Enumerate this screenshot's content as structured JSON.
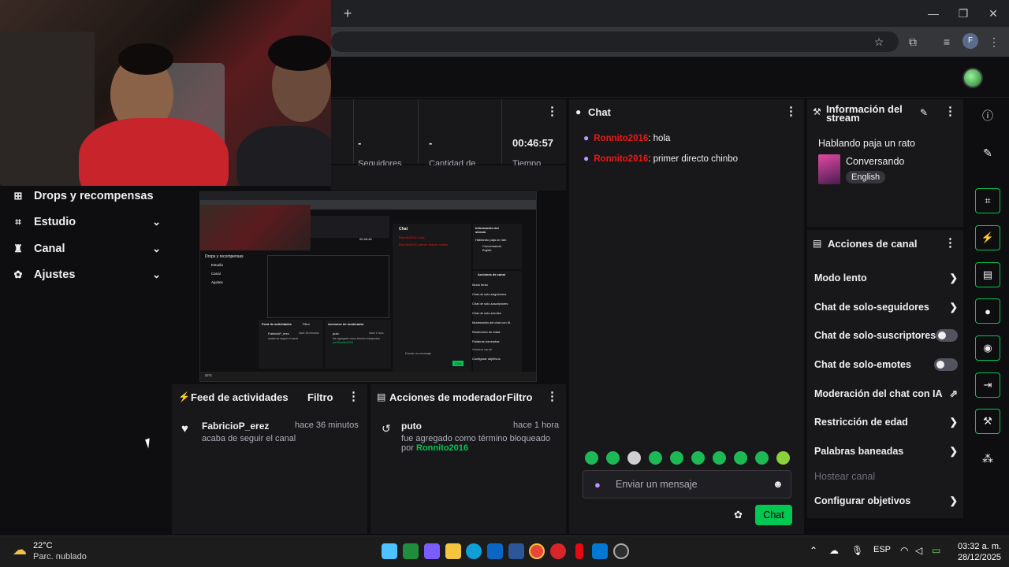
{
  "browser": {
    "new_tab_glyph": "+",
    "window_minimize": "—",
    "window_maximize": "❐",
    "window_close": "✕",
    "profile_initial": "F"
  },
  "stats": {
    "followers_value": "-",
    "followers_label": "Seguidores",
    "amount_value": "-",
    "amount_label": "Cantidad de",
    "time_value": "00:46:57",
    "time_label": "Tiempo"
  },
  "sidebar": {
    "items": [
      {
        "label": "Drops y recompensas",
        "icon": "gift-icon"
      },
      {
        "label": "Estudio",
        "icon": "studio-icon"
      },
      {
        "label": "Canal",
        "icon": "channel-icon"
      },
      {
        "label": "Ajustes",
        "icon": "gear-icon"
      }
    ]
  },
  "activity_feed": {
    "title": "Feed de actividades",
    "filter": "Filtro",
    "user": "FabricioP_erez",
    "time": "hace 36 minutos",
    "text": "acaba de seguir el canal"
  },
  "mod_actions": {
    "title": "Acciones de moderador",
    "filter": "Filtro",
    "term": "puto",
    "time": "hace 1 hora",
    "text": "fue agregado como término bloqueado",
    "by": "por",
    "moderator": "Ronnito2016"
  },
  "chat": {
    "title": "Chat",
    "messages": [
      {
        "user": "Ronnito2016",
        "text": ": hola"
      },
      {
        "user": "Ronnito2016",
        "text": ": primer directo chinbo"
      }
    ],
    "input_placeholder": "Enviar un mensaje",
    "send_label": "Chat"
  },
  "stream_info": {
    "title_line1": "Información del",
    "title_line2": "stream",
    "stream_title": "Hablando paja un rato",
    "category": "Conversando",
    "language": "English"
  },
  "channel_actions": {
    "title": "Acciones de canal",
    "items": [
      {
        "label": "Modo lento",
        "control": "chevron"
      },
      {
        "label": "Chat de solo-seguidores",
        "control": "chevron"
      },
      {
        "label": "Chat de solo-suscriptores",
        "control": "toggle"
      },
      {
        "label": "Chat de solo-emotes",
        "control": "toggle"
      },
      {
        "label": "Moderación del chat con IA",
        "control": "external"
      },
      {
        "label": "Restricción de edad",
        "control": "chevron"
      },
      {
        "label": "Palabras baneadas",
        "control": "chevron"
      },
      {
        "label": "Hostear canal",
        "control": "none"
      },
      {
        "label": "Configurar objetivos",
        "control": "chevron"
      }
    ]
  },
  "taskbar": {
    "weather_temp": "22°C",
    "weather_desc": "Parc. nublado",
    "language": "ESP",
    "time": "03:32 a. m.",
    "date": "28/12/2025"
  },
  "preview": {
    "side_labels": [
      "Drops y recompensas",
      "Estudio",
      "Canal",
      "Ajustes"
    ],
    "chat_title": "Chat",
    "info_title": "Información del stream",
    "stream_title": "Hablando paja un rato",
    "category": "Conversando",
    "language": "English",
    "action_labels": [
      "Acciones de canal",
      "Modo lento",
      "Chat de solo-seguidores",
      "Chat de solo-suscriptores",
      "Chat de solo-emotes",
      "Moderación del chat con IA",
      "Restricción de edad",
      "Palabras baneadas",
      "Hostear canal",
      "Configurar objetivos"
    ],
    "feed_title": "Feed de actividades",
    "mod_title": "Acciones de moderador",
    "filter": "Filtro",
    "feed_user": "FabricioP_erez",
    "feed_time": "hace 36 minutos",
    "feed_text": "acaba de seguir el canal",
    "mod_term": "puto",
    "mod_time": "hace 1 hora",
    "mod_text": "fue agregado como término bloqueado",
    "mod_by": "por Ronnito2016",
    "chat_msg1": "Ronnito2016: hola",
    "chat_msg2": "Ronnito2016: primer directo chinbo",
    "chat_input": "Enviar un mensaje",
    "send": "Chat",
    "time": "00:46:48",
    "weather": "22°C"
  },
  "colors": {
    "accent_green": "#00c853",
    "username_red": "#e91916",
    "panel_bg": "#18181b",
    "page_bg": "#0e0e10"
  }
}
